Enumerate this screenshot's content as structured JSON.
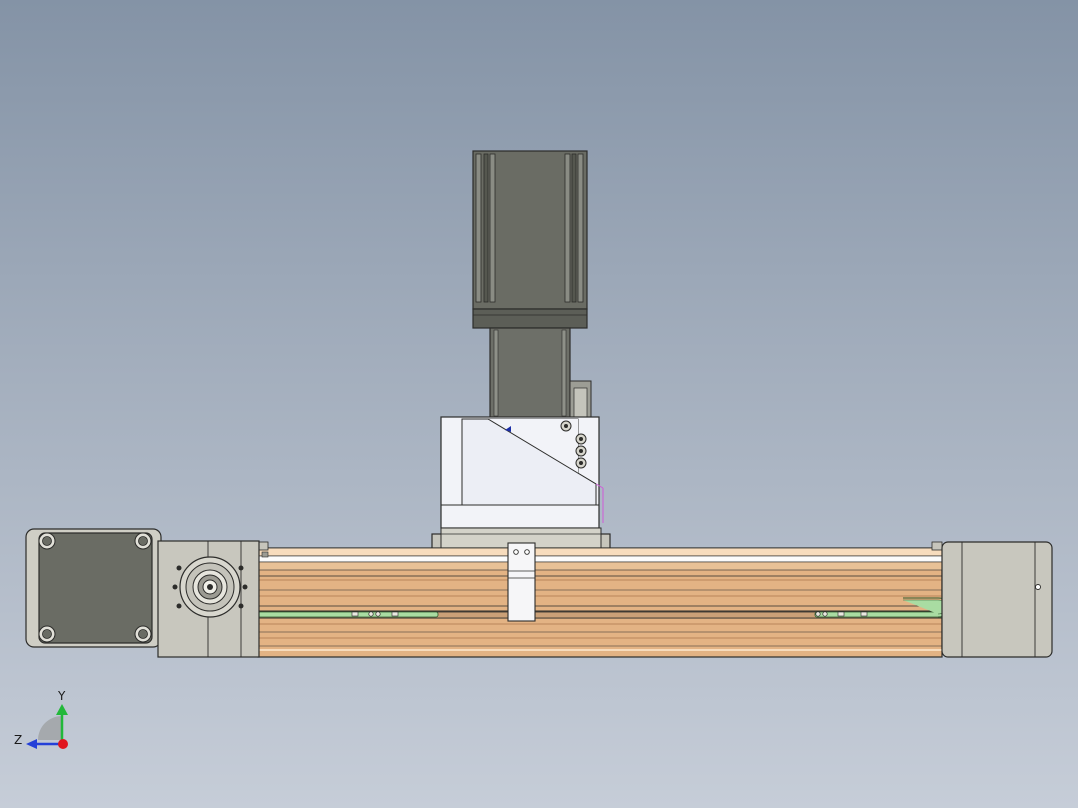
{
  "viewport": {
    "background_top": "#8493a6",
    "background_bottom": "#c6cdd8"
  },
  "model": {
    "parts": [
      "stepper-motor",
      "motor-reducer-column",
      "carriage-bracket",
      "carriage-slider",
      "clamp-plate",
      "linear-rail-body",
      "drive-motor-flange",
      "end-bearing-housing",
      "end-cap"
    ],
    "colors": {
      "motor_body": "#6a6c64",
      "rail_profile": "#e3b384",
      "rail_highlight": "#f7dcbd",
      "rail_shadow": "#b8865a",
      "housing_gray": "#c8c7be",
      "bracket_white": "#f2f3f8",
      "belt_green": "#a9dca2"
    }
  },
  "triad": {
    "y_label": "Y",
    "z_label": "Z",
    "y_color": "#22b83a",
    "z_color": "#2440d8",
    "origin_color": "#e0141e"
  }
}
